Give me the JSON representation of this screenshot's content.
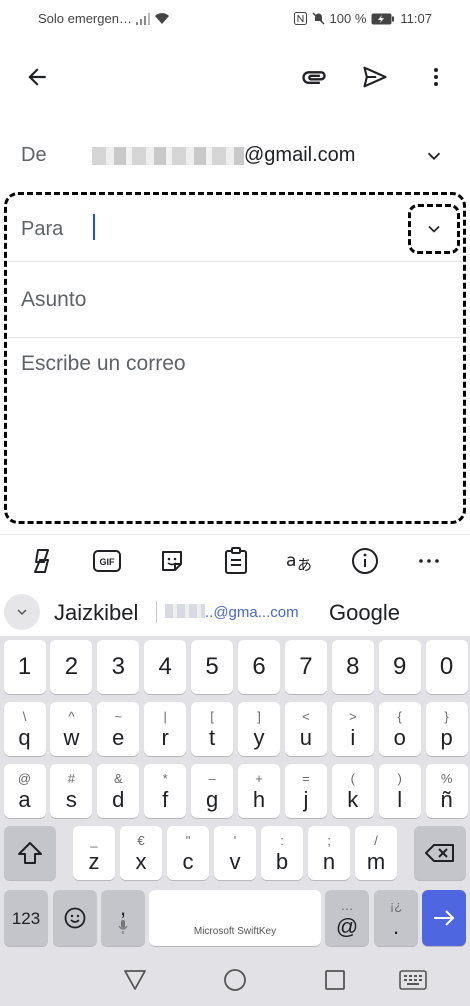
{
  "status_bar": {
    "carrier": "Solo emergen…",
    "battery_percent": "100 %",
    "time": "11:07",
    "icons": [
      "signal-icon",
      "wifi-icon",
      "nfc-icon",
      "mute-icon",
      "battery-charging-icon"
    ]
  },
  "app_bar": {
    "icons": [
      "back-arrow-icon",
      "attach-icon",
      "send-icon",
      "more-vert-icon"
    ]
  },
  "compose": {
    "from_label": "De",
    "from_email_domain": "@gmail.com",
    "to_label": "Para",
    "subject_placeholder": "Asunto",
    "body_placeholder": "Escribe un correo"
  },
  "keyboard_toolbar": {
    "tools": [
      "copilot-icon",
      "gif-icon",
      "sticker-icon",
      "clipboard-icon",
      "translate-icon",
      "info-icon",
      "more-horiz-icon"
    ]
  },
  "suggestions": {
    "first": "Jaizkibel",
    "email_suffix": "..@gma...com",
    "third": "Google"
  },
  "keyboard": {
    "number_row": [
      "1",
      "2",
      "3",
      "4",
      "5",
      "6",
      "7",
      "8",
      "9",
      "0"
    ],
    "row1": [
      {
        "main": "q",
        "sec": "\\"
      },
      {
        "main": "w",
        "sec": "^"
      },
      {
        "main": "e",
        "sec": "~"
      },
      {
        "main": "r",
        "sec": "|"
      },
      {
        "main": "t",
        "sec": "["
      },
      {
        "main": "y",
        "sec": "]"
      },
      {
        "main": "u",
        "sec": "<"
      },
      {
        "main": "i",
        "sec": ">"
      },
      {
        "main": "o",
        "sec": "{"
      },
      {
        "main": "p",
        "sec": "}"
      }
    ],
    "row2": [
      {
        "main": "a",
        "sec": "@"
      },
      {
        "main": "s",
        "sec": "#"
      },
      {
        "main": "d",
        "sec": "&"
      },
      {
        "main": "f",
        "sec": "*"
      },
      {
        "main": "g",
        "sec": "–"
      },
      {
        "main": "h",
        "sec": "+"
      },
      {
        "main": "j",
        "sec": "="
      },
      {
        "main": "k",
        "sec": "("
      },
      {
        "main": "l",
        "sec": ")"
      },
      {
        "main": "ñ",
        "sec": "%"
      }
    ],
    "row3": [
      {
        "main": "z",
        "sec": "_"
      },
      {
        "main": "x",
        "sec": "€"
      },
      {
        "main": "c",
        "sec": "\""
      },
      {
        "main": "v",
        "sec": "'"
      },
      {
        "main": "b",
        "sec": ":"
      },
      {
        "main": "n",
        "sec": ";"
      },
      {
        "main": "m",
        "sec": "/"
      }
    ],
    "num_switch": "123",
    "comma": ",",
    "comma_sec": "🎙",
    "space_label": "Microsoft SwiftKey",
    "at": "@",
    "at_sec": "…",
    "period": ".",
    "period_sec": "¡¿"
  },
  "nav_bar": {
    "icons": [
      "back-triangle-icon",
      "home-circle-icon",
      "recents-square-icon",
      "keyboard-icon"
    ]
  },
  "colors": {
    "accent": "#4e67e0",
    "caret": "#1a57c8",
    "link": "#4a66c9"
  }
}
